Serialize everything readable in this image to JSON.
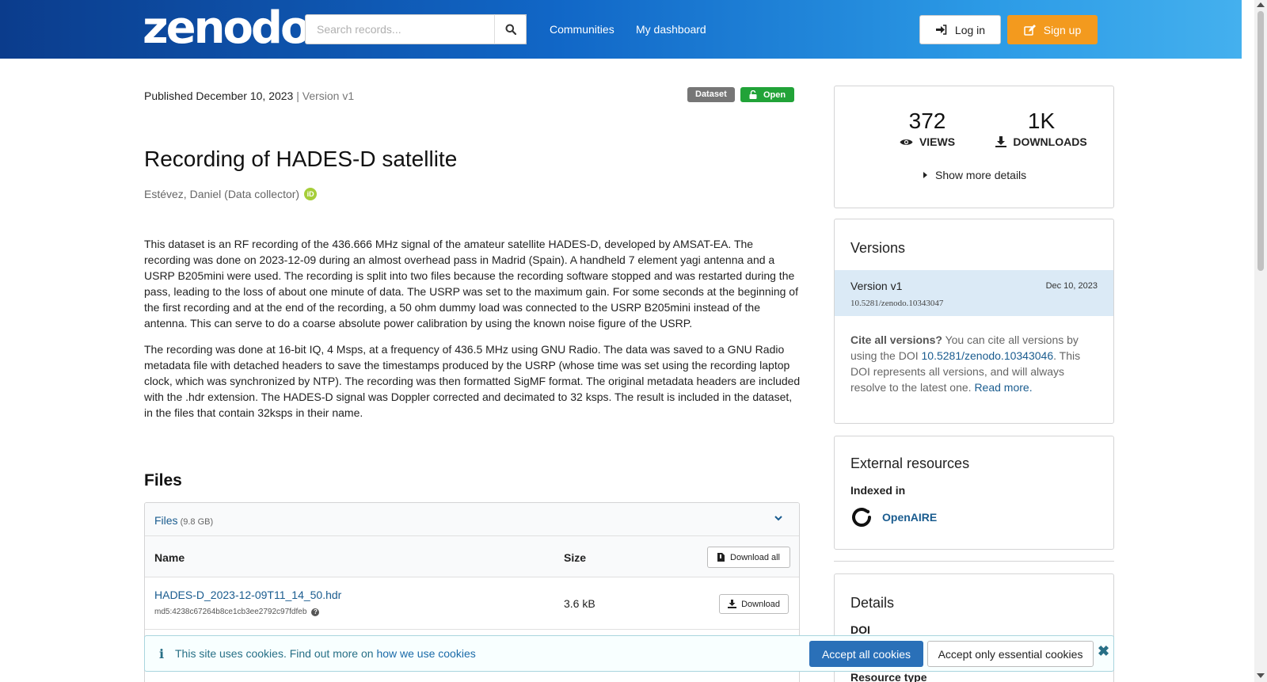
{
  "header": {
    "logo": "zenodo",
    "search_placeholder": "Search records...",
    "nav": [
      "Communities",
      "My dashboard"
    ],
    "login_label": "Log in",
    "signup_label": "Sign up"
  },
  "record": {
    "published": "Published December 10, 2023",
    "version_sep": " | ",
    "version": "Version v1",
    "badge_type": "Dataset",
    "badge_access": "Open",
    "title": "Recording of HADES-D satellite",
    "creator": "Estévez, Daniel (Data collector)",
    "orcid_label": "iD",
    "description": [
      "This dataset is an RF recording of the 436.666 MHz signal of the amateur satellite HADES-D, developed by AMSAT-EA. The recording was done on 2023-12-09 during an almost overhead pass in Madrid (Spain). A handheld 7 element yagi antenna and a USRP B205mini were used. The recording is split into two files because the recording software stopped and was restarted during the pass, leading to the loss of about one minute of data. The USRP was set to the maximum gain. For some seconds at the beginning of the first recording and at the end of the recording, a 50 ohm dummy load was connected to the USRP B205mini instead of the antenna. This can serve to do a coarse absolute power calibration by using the known noise figure of the USRP.",
      "The recording was done at 16-bit IQ, 4 Msps, at a frequency of 436.5 MHz using GNU Radio. The data was saved to a GNU Radio metadata file with detached headers to save the timestamps produced by the USRP (whose time was set using the recording laptop clock, which was synchronized by NTP). The recording was then formatted SigMF format. The original metadata headers are included with the .hdr extension. The HADES-D signal was Doppler corrected and decimated to 32 ksps. The result is included in the dataset, in the files that contain 32ksps in their name."
    ]
  },
  "files": {
    "heading": "Files",
    "bar_label": "Files",
    "bar_size": "(9.8 GB)",
    "col_name": "Name",
    "col_size": "Size",
    "download_all": "Download all",
    "rows": [
      {
        "name": "HADES-D_2023-12-09T11_14_50.hdr",
        "md5": "md5:4238c67264b8ce1cb3ee2792c97fdfeb",
        "size": "3.6 kB",
        "download": "Download"
      }
    ]
  },
  "stats": {
    "views": "372",
    "views_label": "VIEWS",
    "downloads": "1K",
    "downloads_label": "DOWNLOADS",
    "more": "Show more details"
  },
  "versions": {
    "heading": "Versions",
    "current_label": "Version v1",
    "current_date": "Dec 10, 2023",
    "current_doi": "10.5281/zenodo.10343047",
    "cite_bold": "Cite all versions?",
    "cite_text1": " You can cite all versions by using the DOI ",
    "cite_doi": "10.5281/zenodo.10343046",
    "cite_text2": ". This DOI represents all versions, and will always resolve to the latest one. ",
    "read_more": "Read more."
  },
  "external": {
    "heading": "External resources",
    "indexed_in": "Indexed in",
    "resource": "OpenAIRE"
  },
  "details": {
    "heading": "Details",
    "doi_label": "DOI",
    "resource_type_label": "Resource type"
  },
  "cookie": {
    "message": "This site uses cookies. Find out more on ",
    "link": "how we use cookies",
    "accept_all": "Accept all cookies",
    "accept_essential": "Accept only essential cookies"
  },
  "colors": {
    "brand_orange": "#f39a1e",
    "open_green": "#21a338",
    "link_blue": "#1a5c8f"
  }
}
